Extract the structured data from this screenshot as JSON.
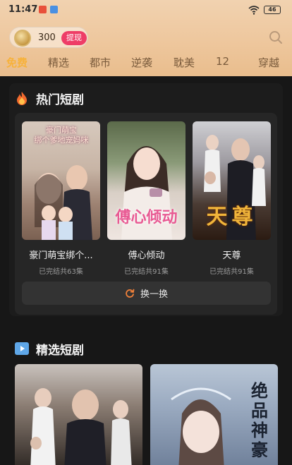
{
  "status": {
    "time": "11:47",
    "battery": "46"
  },
  "header": {
    "coins": "300",
    "withdraw_label": "提现",
    "tabs": [
      {
        "label": "免费"
      },
      {
        "label": "精选"
      },
      {
        "label": "都市"
      },
      {
        "label": "逆袭"
      },
      {
        "label": "耽美"
      },
      {
        "label": "12"
      },
      {
        "label": "穿越"
      }
    ]
  },
  "hot": {
    "title": "热门短剧",
    "items": [
      {
        "title": "豪门萌宝绑个...",
        "sub": "已完结共63集",
        "poster_text": "豪门萌宝\n绑个爹地宠妈咪"
      },
      {
        "title": "傅心倾动",
        "sub": "已完结共91集",
        "poster_text": "傅心倾动"
      },
      {
        "title": "天尊",
        "sub": "已完结共91集",
        "poster_text": "天尊"
      }
    ],
    "swap_label": "换一换"
  },
  "featured": {
    "title": "精选短剧",
    "items": [
      {
        "poster_text": ""
      },
      {
        "poster_text": "绝品神豪"
      }
    ]
  },
  "colors": {
    "accent": "#f7b23b",
    "withdraw": "#ee3d67",
    "tab_inactive": "#7a5b3c"
  }
}
